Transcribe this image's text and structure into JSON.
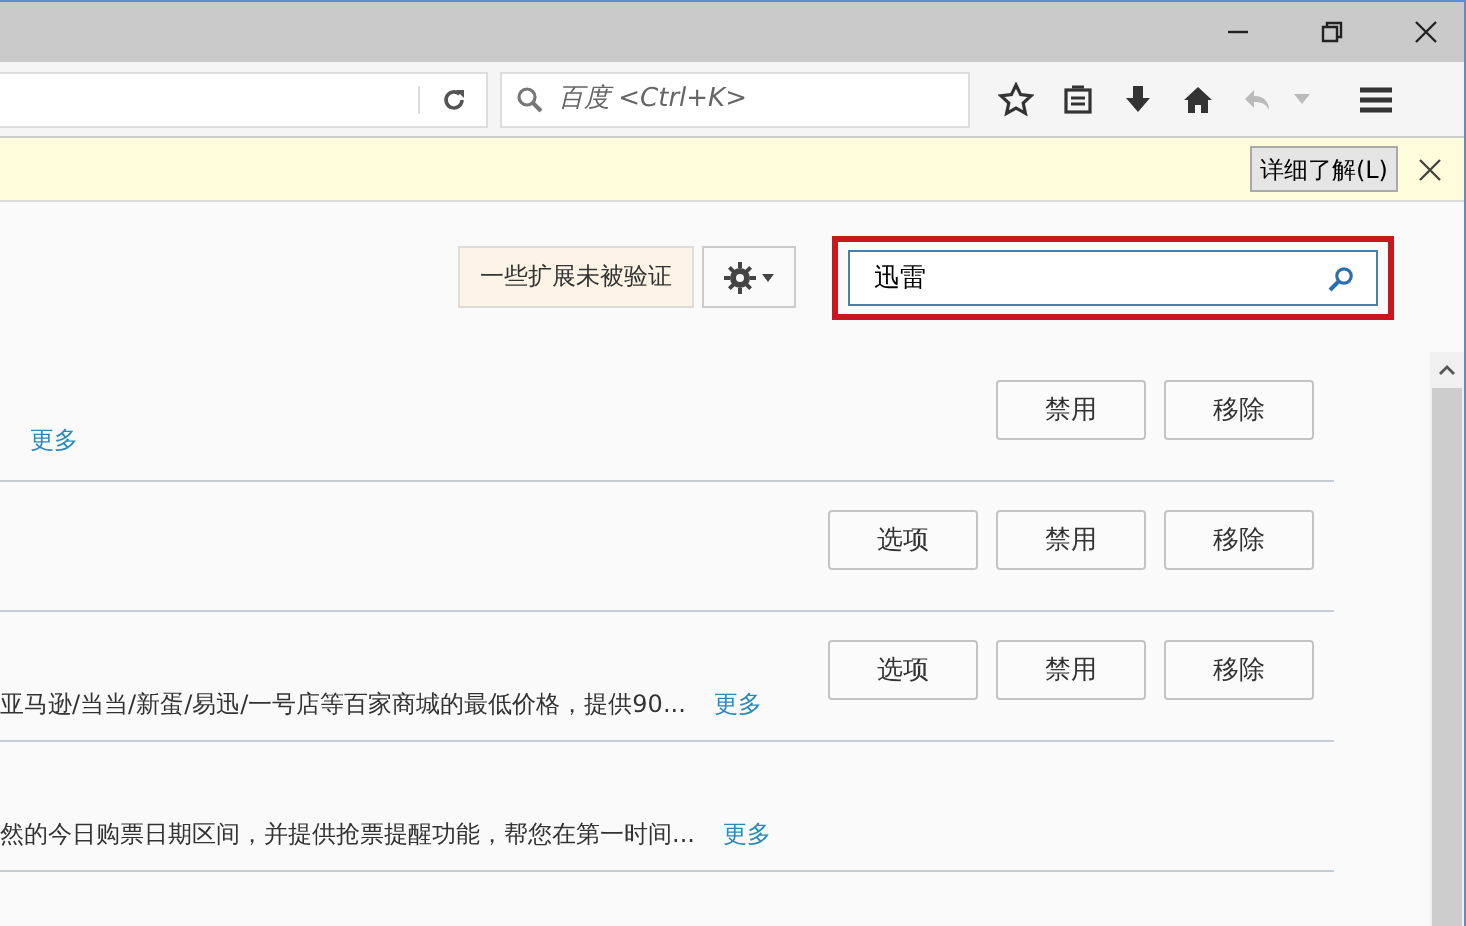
{
  "toolbar": {
    "search_placeholder": "百度 <Ctrl+K>"
  },
  "notification": {
    "button": "详细了解(L)"
  },
  "header": {
    "unverified_button": "一些扩展未被验证",
    "search_value": "迅雷"
  },
  "addons": [
    {
      "more": "更多",
      "buttons": [
        "禁用",
        "移除"
      ]
    },
    {
      "buttons": [
        "选项",
        "禁用",
        "移除"
      ]
    },
    {
      "description": "亚马逊/当当/新蛋/易迅/一号店等百家商城的最低价格，提供90...",
      "more": "更多",
      "buttons": [
        "选项",
        "禁用",
        "移除"
      ]
    },
    {
      "description": "然的今日购票日期区间，并提供抢票提醒功能，帮您在第一时间...",
      "more": "更多"
    }
  ]
}
